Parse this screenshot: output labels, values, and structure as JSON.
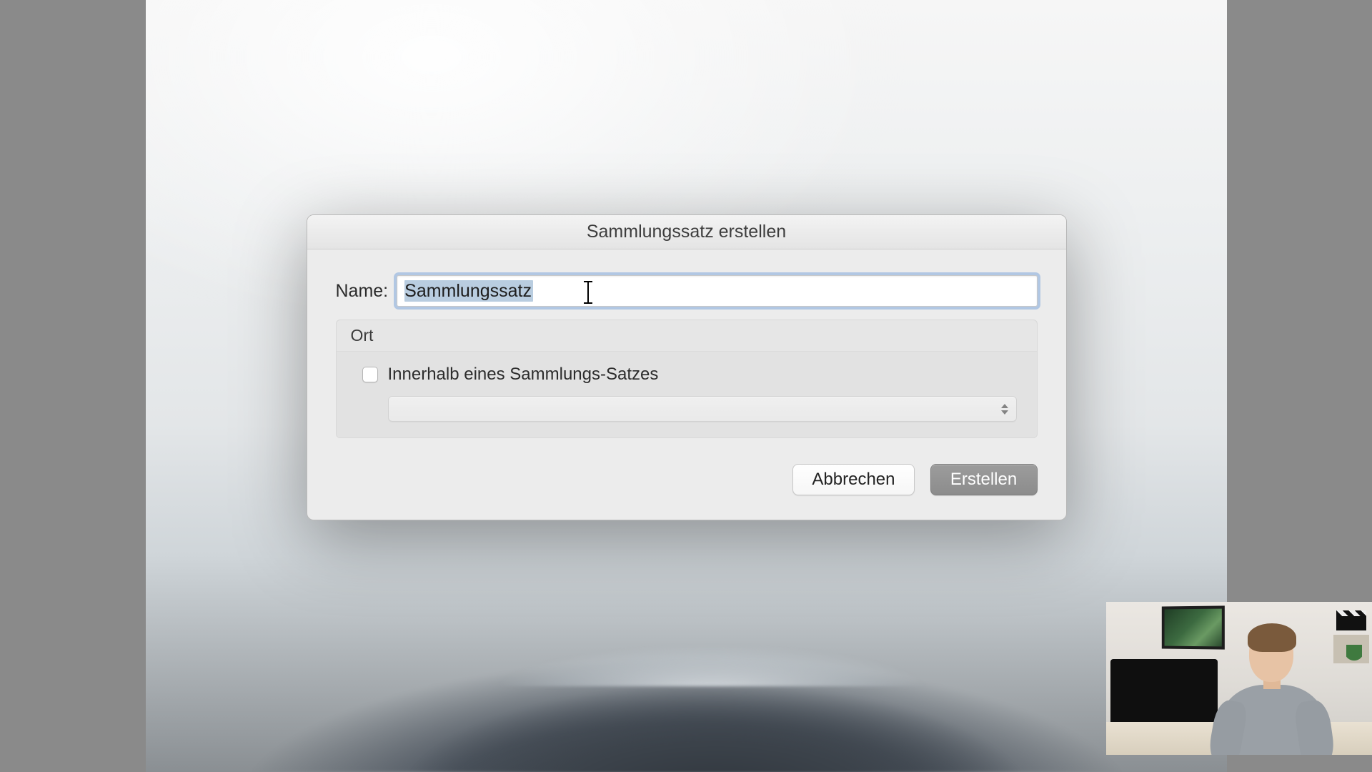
{
  "dialog": {
    "title": "Sammlungssatz erstellen",
    "name_label": "Name:",
    "name_value": "Sammlungssatz",
    "location_group_label": "Ort",
    "inside_checkbox_label": "Innerhalb eines Sammlungs-Satzes",
    "inside_checkbox_checked": false,
    "parent_select_value": "",
    "cancel_label": "Abbrechen",
    "create_label": "Erstellen"
  }
}
